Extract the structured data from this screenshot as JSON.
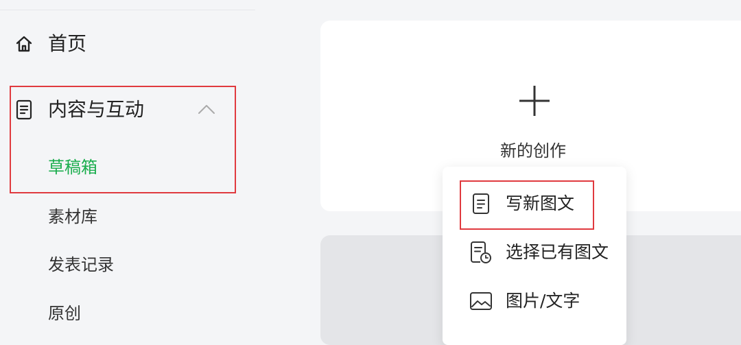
{
  "sidebar": {
    "home_label": "首页",
    "content_label": "内容与互动",
    "content_items": [
      "草稿箱",
      "素材库",
      "发表记录",
      "原创"
    ]
  },
  "create_card": {
    "label": "新的创作"
  },
  "create_menu": {
    "items": [
      {
        "label": "写新图文",
        "icon": "article-icon"
      },
      {
        "label": "选择已有图文",
        "icon": "article-clock-icon"
      },
      {
        "label": "图片/文字",
        "icon": "image-icon"
      }
    ]
  },
  "colors": {
    "active": "#1aad4d",
    "highlight": "#e0393e",
    "background": "#f4f5f7"
  }
}
